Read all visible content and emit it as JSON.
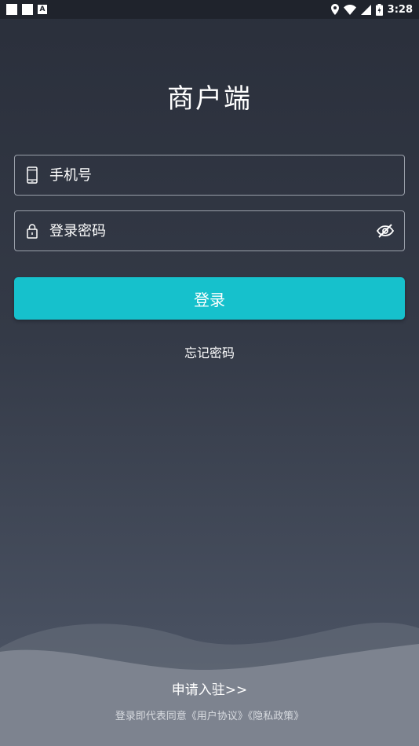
{
  "status_bar": {
    "time": "3:28",
    "notif_letter": "A"
  },
  "title": "商户端",
  "phone": {
    "placeholder": "手机号"
  },
  "password": {
    "placeholder": "登录密码"
  },
  "login_button": "登录",
  "forgot_password": "忘记密码",
  "apply": "申请入驻>>",
  "agreement": {
    "prefix": "登录即代表同意",
    "user_agreement": "《用户协议》",
    "privacy_policy": "《隐私政策》"
  },
  "colors": {
    "accent": "#16c1cc",
    "background_top": "#2a2f3b",
    "background_bottom": "#555d6b",
    "field_border": "#9aa0aa"
  }
}
